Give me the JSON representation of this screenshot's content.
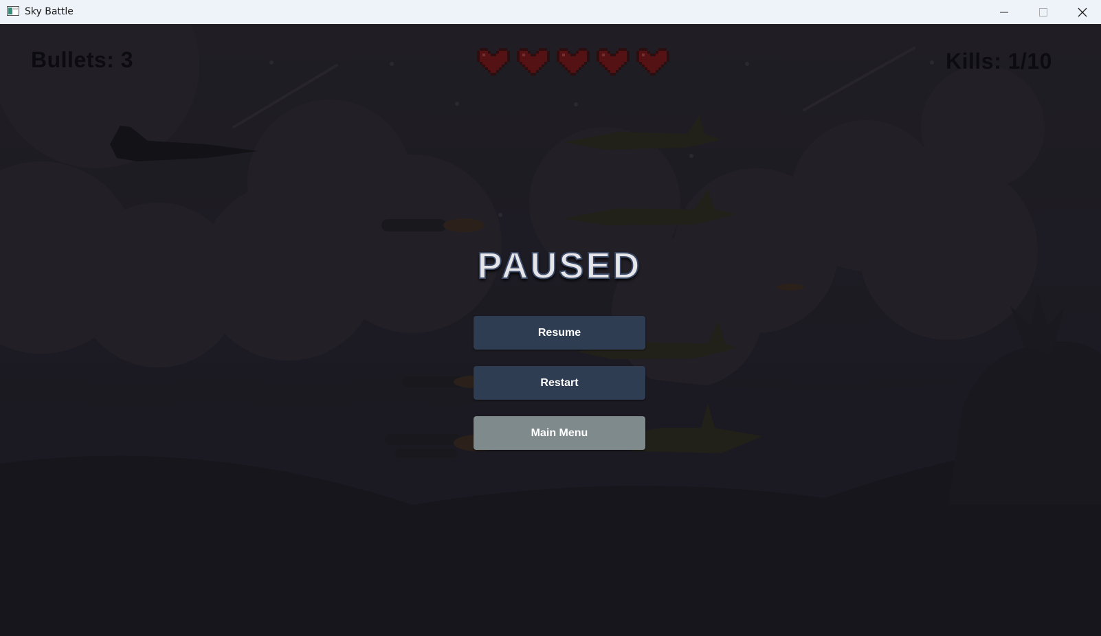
{
  "window": {
    "title": "Sky Battle",
    "icon": "app-window-icon",
    "controls": [
      "minimize-icon",
      "maximize-icon",
      "close-icon"
    ]
  },
  "hud": {
    "bullets_text": "Bullets: 3",
    "kills_text": "Kills: 1/10",
    "lives": 5,
    "heart_color": "#7a1414"
  },
  "pause_menu": {
    "title": "PAUSED",
    "resume_label": "Resume",
    "restart_label": "Restart",
    "main_menu_label": "Main Menu"
  },
  "colors": {
    "button_primary": "#2e3d52",
    "button_secondary": "#7e8a8b",
    "overlay": "#0f0f15"
  }
}
